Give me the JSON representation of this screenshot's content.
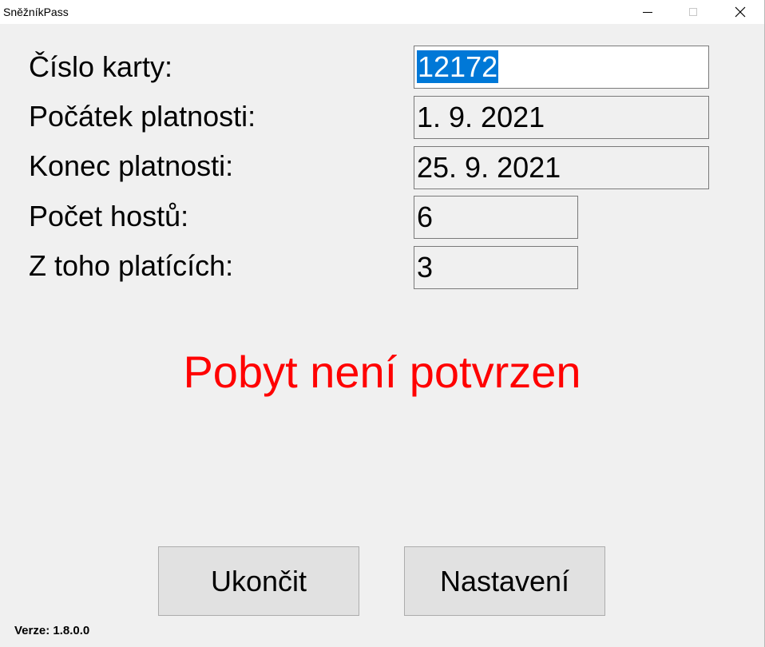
{
  "window": {
    "title": "SněžníkPass",
    "controls": {
      "minimize_icon": "minimize-icon",
      "maximize_icon": "maximize-icon",
      "close_icon": "close-icon",
      "close_glyph": "✕"
    }
  },
  "form": {
    "card_number": {
      "label": "Číslo karty:",
      "value": "12172",
      "selected": true
    },
    "valid_from": {
      "label": "Počátek platnosti:",
      "value": "1. 9. 2021"
    },
    "valid_to": {
      "label": "Konec platnosti:",
      "value": "25. 9. 2021"
    },
    "guest_count": {
      "label": "Počet hostů:",
      "value": "6"
    },
    "paying_count": {
      "label": "Z toho platících:",
      "value": "3"
    }
  },
  "status": {
    "text": "Pobyt není potvrzen",
    "color": "#ff0000"
  },
  "buttons": {
    "exit_label": "Ukončit",
    "settings_label": "Nastavení"
  },
  "footer": {
    "version": "Verze: 1.8.0.0"
  },
  "colors": {
    "selection": "#0078d7",
    "status_error": "#ff0000",
    "window_bg": "#f0f0f0"
  }
}
